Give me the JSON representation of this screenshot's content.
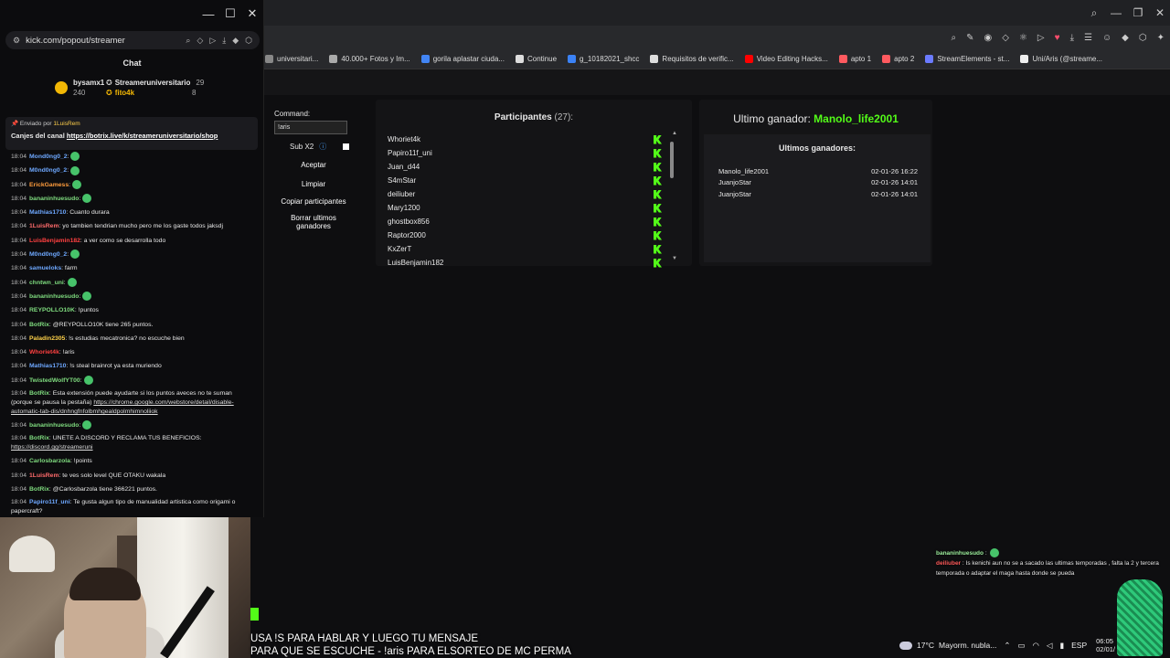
{
  "chat": {
    "window_controls": {
      "minimize": "—",
      "maximize": "☐",
      "close": "✕"
    },
    "url": "kick.com/popout/streamer",
    "title": "Chat",
    "top_gifters": [
      {
        "name": "bysamx1",
        "count": "240"
      },
      {
        "name": "Streameruniversitario",
        "count": "29"
      },
      {
        "name": "fito4k",
        "count": "8"
      }
    ],
    "pinned": {
      "label": "Enviado por",
      "sender": "1LuisRem",
      "text_prefix": "Canjes del canal",
      "link": "https://botrix.live/k/streameruniversitario/shop"
    },
    "messages": [
      {
        "time": "18:04",
        "user": "Mond0ng0_2",
        "color": "#6ea8ff",
        "text": ":",
        "emote": true
      },
      {
        "time": "18:04",
        "user": "M0nd0ng0_2",
        "color": "#6ea8ff",
        "text": ":",
        "emote": true
      },
      {
        "time": "18:04",
        "user": "ErickGamess",
        "color": "#ff9d3d",
        "text": ":",
        "emote": true
      },
      {
        "time": "18:04",
        "user": "bananinhuesudo",
        "color": "#7fdc7f",
        "text": ":",
        "emote": true
      },
      {
        "time": "18:04",
        "user": "Mathias1710",
        "color": "#6ea8ff",
        "text": ": Cuanto durara"
      },
      {
        "time": "18:04",
        "user": "1LuisRem",
        "color": "#ff6b6b",
        "text": ": yo tambien tendrian mucho pero me los gaste todos jaksdj"
      },
      {
        "time": "18:04",
        "user": "LuisBenjamin182",
        "color": "#ff4040",
        "text": ": a ver como se desarrolla todo"
      },
      {
        "time": "18:04",
        "user": "M0nd0ng0_2",
        "color": "#6ea8ff",
        "text": ":",
        "emote": true
      },
      {
        "time": "18:04",
        "user": "samueloks",
        "color": "#6ea8ff",
        "text": ": farm"
      },
      {
        "time": "18:04",
        "user": "chntwn_uni",
        "color": "#7fdc7f",
        "text": ":",
        "emote": true
      },
      {
        "time": "18:04",
        "user": "bananinhuesudo",
        "color": "#7fdc7f",
        "text": ":",
        "emote": true
      },
      {
        "time": "18:04",
        "user": "REYPOLLO10K",
        "color": "#7fdc7f",
        "text": ": !puntos"
      },
      {
        "time": "18:04",
        "user": "BotRix",
        "color": "#7fdc7f",
        "text": ": @REYPOLLO10K tiene 265 puntos."
      },
      {
        "time": "18:04",
        "user": "Paladin2305",
        "color": "#ffd24a",
        "text": ": !s estudias mecatronica? no escuche bien"
      },
      {
        "time": "18:04",
        "user": "Whoriet4k",
        "color": "#ff4040",
        "text": ": !aris"
      },
      {
        "time": "18:04",
        "user": "Mathias1710",
        "color": "#6ea8ff",
        "text": ": !s steal brainrot ya esta muriendo"
      },
      {
        "time": "18:04",
        "user": "TwistedWolfYT00",
        "color": "#7fdc7f",
        "text": ":",
        "emote": true
      }
    ],
    "botrix_ext": {
      "time": "18:04",
      "user": "BotRix",
      "text": ": Esta extensión puede ayudarte si los puntos aveces no te suman (porque se pausa la pestaña)",
      "link": "https://chrome.google.com/webstore/detail/disable-automatic-tab-dis/dnhngfnfolbmhgealdpolmhimnoliiok"
    },
    "messages2": [
      {
        "time": "18:04",
        "user": "bananinhuesudo",
        "color": "#7fdc7f",
        "text": ":",
        "emote": true
      }
    ],
    "botrix_discord": {
      "time": "18:04",
      "user": "BotRix",
      "text": ": UNETE A DISCORD Y RECLAMA TUS BENEFICIOS:",
      "link": "https://discord.gg/streameruni"
    },
    "messages3": [
      {
        "time": "18:04",
        "user": "Carlosbarzola",
        "color": "#7fdc7f",
        "text": ": !points"
      },
      {
        "time": "18:04",
        "user": "1LuisRem",
        "color": "#ff6b6b",
        "text": ": te ves solo level QUE OTAKU wakala"
      },
      {
        "time": "18:04",
        "user": "BotRix",
        "color": "#7fdc7f",
        "text": ": @Carlosbarzola tiene 366221 puntos."
      }
    ],
    "last_msg": {
      "time": "18:04",
      "user": "Papiro11f_uni",
      "text": ": Te gusta algun tipo de manualidad artistica como origami o papercraft?"
    }
  },
  "browser": {
    "bookmarks": [
      {
        "label": "universitari...",
        "color": "#888"
      },
      {
        "label": "40.000+ Fotos y Im...",
        "color": "#aaa"
      },
      {
        "label": "gorila aplastar ciuda...",
        "color": "#4285f4"
      },
      {
        "label": "Continue",
        "color": "#ddd"
      },
      {
        "label": "g_10182021_shcc",
        "color": "#3b82f6"
      },
      {
        "label": "Requisitos de verific...",
        "color": "#ddd"
      },
      {
        "label": "Video Editing Hacks...",
        "color": "#ff0000"
      },
      {
        "label": "apto 1",
        "color": "#ff5a5f"
      },
      {
        "label": "apto 2",
        "color": "#ff5a5f"
      },
      {
        "label": "StreamElements - st...",
        "color": "#6b7bff"
      },
      {
        "label": "Uni/Aris (@streame...",
        "color": "#eee"
      }
    ]
  },
  "giveaway": {
    "command_label": "Command:",
    "command_value": "!aris",
    "sub_label": "Sub X2",
    "buttons": {
      "accept": "Aceptar",
      "clear": "Limpiar",
      "copy": "Copiar participantes",
      "delete": "Borrar ultimos ganadores"
    },
    "participants_title": "Participantes",
    "participants_count": "(27):",
    "participants": [
      "Whoriet4k",
      "Papiro11f_uni",
      "Juan_d44",
      "S4mStar",
      "deiliuber",
      "Mary1200",
      "ghostbox856",
      "Raptor2000",
      "KxZerT",
      "LuisBenjamin182"
    ],
    "winner_label": "Ultimo ganador:",
    "winner_name": "Manolo_life2001",
    "last_title": "Ultimos ganadores:",
    "last_winners": [
      {
        "name": "Manolo_life2001",
        "date": "02-01-26 16:22"
      },
      {
        "name": "JuanjoStar",
        "date": "02-01-26 14:01"
      },
      {
        "name": "JuanjoStar",
        "date": "02-01-26 14:01"
      }
    ]
  },
  "overlay": {
    "chat1_user": "bananinhuesudo",
    "chat2_user": "deiliuber",
    "chat2_text": ": Is kenichi aun no se a sacado las ultimas temporadas , falta la 2 y tercera temporada o adaptar el maga hasta donde se pueda",
    "ticker_line1": "USA !S PARA HABLAR Y LUEGO TU MENSAJE",
    "ticker_line2": "PARA QUE SE ESCUCHE - !aris PARA ELSORTEO DE MC PERMA"
  },
  "taskbar": {
    "temp": "17°C",
    "weather": "Mayorm. nubla...",
    "lang": "ESP",
    "time": "06:05",
    "date": "02/01/"
  }
}
